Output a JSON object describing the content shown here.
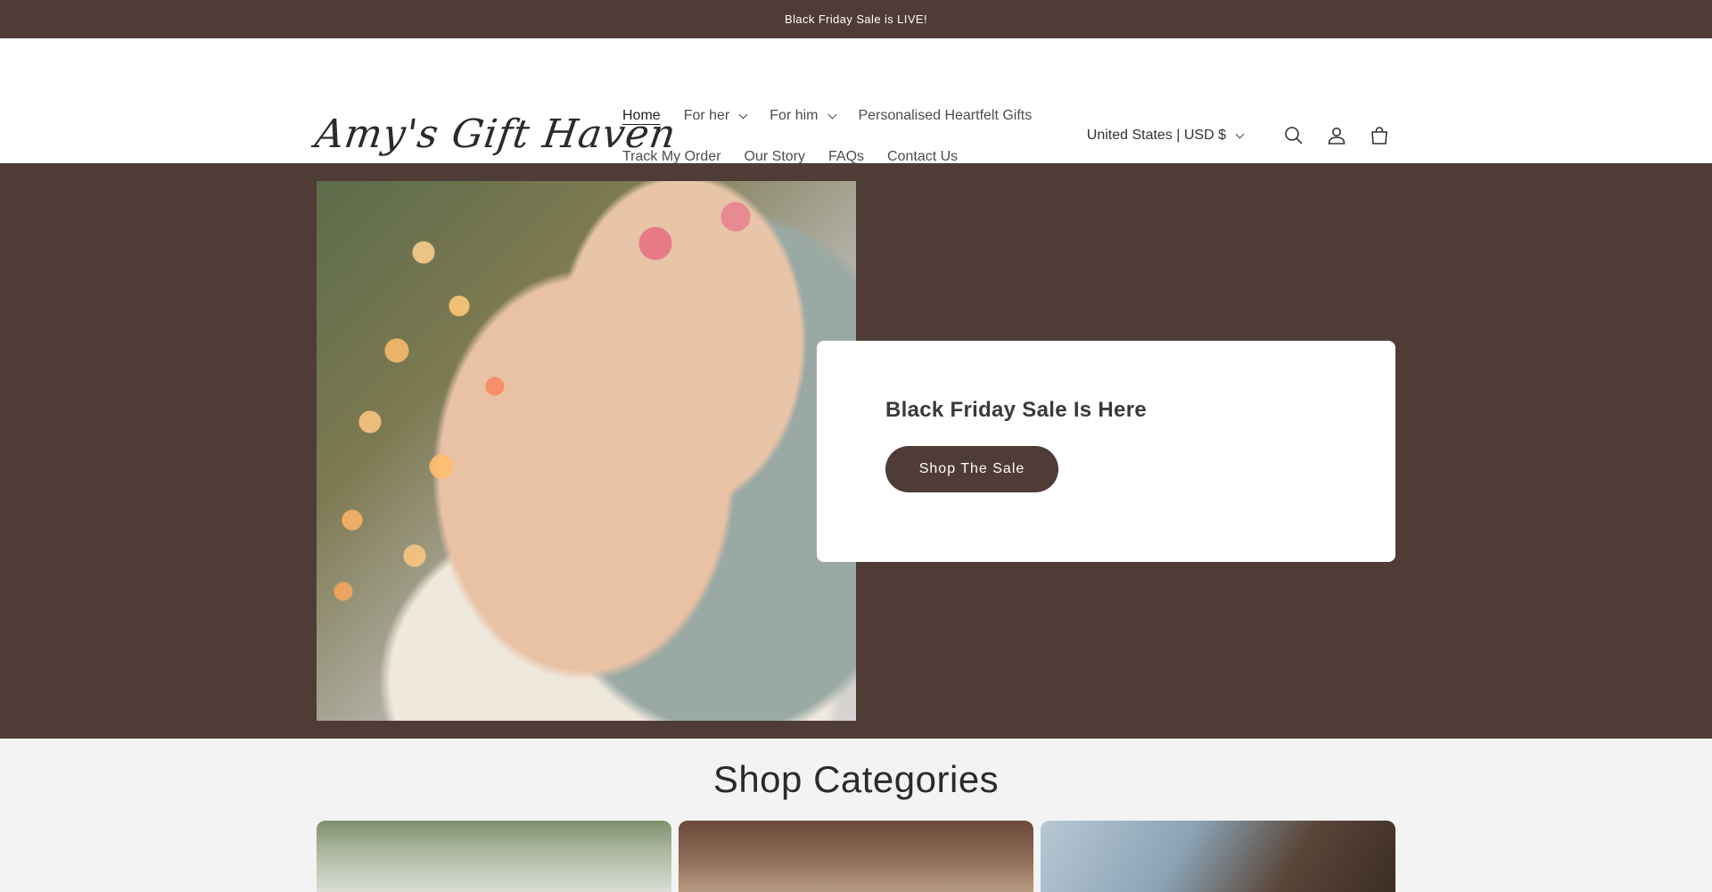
{
  "announcement": {
    "text": "Black Friday Sale is LIVE!"
  },
  "header": {
    "logo_text": "Amy's Gift Haven",
    "nav_row1": [
      {
        "label": "Home",
        "active": true
      },
      {
        "label": "For her",
        "dropdown": true
      },
      {
        "label": "For him",
        "dropdown": true
      },
      {
        "label": "Personalised Heartfelt Gifts"
      }
    ],
    "nav_row2": [
      {
        "label": "Track My Order"
      },
      {
        "label": "Our Story"
      },
      {
        "label": "FAQs"
      },
      {
        "label": "Contact Us"
      }
    ],
    "currency": "United States | USD $",
    "icons": [
      "search-icon",
      "account-icon",
      "cart-icon"
    ]
  },
  "hero": {
    "heading": "Black Friday Sale Is Here",
    "button_label": "Shop The Sale"
  },
  "categories": {
    "title": "Shop Categories"
  },
  "colors": {
    "brand": "#4f3c37",
    "background": "#f3f3f3",
    "card": "#ffffff"
  }
}
